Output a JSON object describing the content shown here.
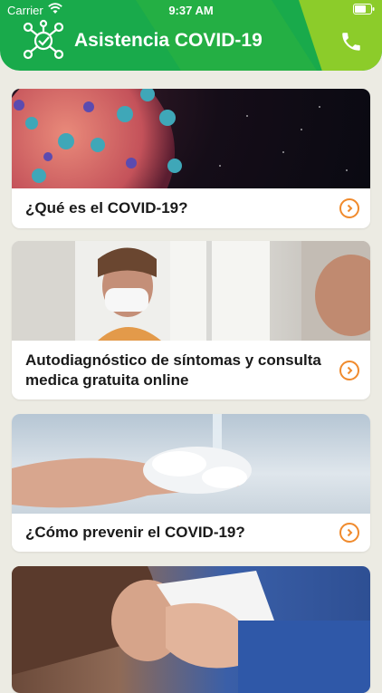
{
  "status": {
    "carrier": "Carrier",
    "time": "9:37 AM"
  },
  "header": {
    "title": "Asistencia COVID-19",
    "logo_icon": "virus-network-icon",
    "call_icon": "phone-icon"
  },
  "colors": {
    "primary": "#19aa4b",
    "accent": "#8ccc2a",
    "arrow": "#f08a2c",
    "background": "#ecebe3"
  },
  "cards": [
    {
      "label": "¿Qué es el COVID-19?",
      "image": "coronavirus-illustration"
    },
    {
      "label": "Autodiagnóstico de síntomas y consulta medica gratuita online",
      "image": "woman-wearing-face-mask"
    },
    {
      "label": "¿Cómo prevenir el COVID-19?",
      "image": "washing-hands-with-soap"
    },
    {
      "label": "",
      "image": "sick-person-with-tissue"
    }
  ]
}
